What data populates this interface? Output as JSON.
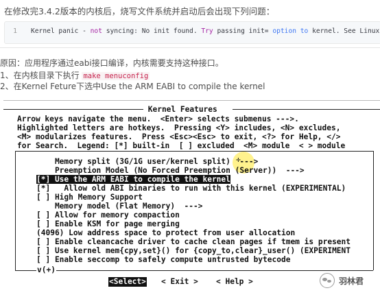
{
  "article": {
    "intro": "在修改完3.4.2版本的内核后，烧写文件系统并启动后会出现下列问题：",
    "code": {
      "line_number": "1",
      "seg1": "Kernel panic - ",
      "seg2": "not",
      "seg3": " syncing: No init found. ",
      "seg4": "Try",
      "seg5": " passing init= ",
      "seg6": "option",
      "seg7": " to",
      "seg8": " kernel. See Linux Documentation/init"
    },
    "reason": "原因：应用程序通过eabi接口编译，内核需要支持这种接口。",
    "step1_prefix": "1、在内核目录下执行 ",
    "step1_code": "make menuconfig",
    "step2": "2、在Kernel Feture下选中Use the ARM EABI to compile the kernel"
  },
  "terminal": {
    "title": " Kernel Features ",
    "help_lines": [
      "Arrow keys navigate the menu.  <Enter> selects submenus --->.",
      "Highlighted letters are hotkeys.  Pressing <Y> includes, <N> excludes,",
      "<M> modularizes features.  Press <Esc><Esc> to exit, <?> for Help, </>",
      "for Search.  Legend: [*] built-in  [ ] excluded  <M> module  < > module"
    ],
    "menu_items": [
      "    Memory split (3G/1G user/kernel split)  --->",
      "    Preemption Model (No Forced Preemption (Server))  --->",
      "[*] Use the ARM EABI to compile the kernel",
      "[*]   Allow old ABI binaries to run with this kernel (EXPERIMENTAL)",
      "[ ] High Memory Support",
      "    Memory model (Flat Memory)  --->",
      "[ ] Allow for memory compaction",
      "[ ] Enable KSM for page merging",
      "(4096) Low address space to protect from user allocation",
      "[ ] Enable cleancache driver to cache clean pages if tmem is present",
      "[ ] Use kernel mem{cpy,set}() for {copy_to,clear}_user() (EXPERIMENT",
      "[ ] Enable seccomp to safely compute untrusted bytecode"
    ],
    "scroll_indicator": "v(+)",
    "buttons": {
      "select": "<Select>",
      "exit": "< Exit >",
      "help": "< Help >"
    }
  },
  "watermark": {
    "icon": "wechat-icon",
    "text": "羽林君"
  }
}
